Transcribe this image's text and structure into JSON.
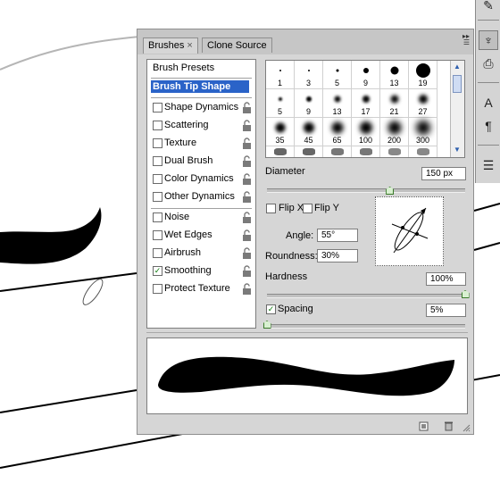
{
  "panel": {
    "tabs": [
      {
        "label": "Brushes",
        "close": "×",
        "active": true
      },
      {
        "label": "Clone Source",
        "active": false
      }
    ],
    "options": [
      {
        "label": "Brush Presets",
        "type": "header"
      },
      {
        "label": "Brush Tip Shape",
        "type": "selected"
      },
      {
        "label": "Shape Dynamics",
        "checked": false
      },
      {
        "label": "Scattering",
        "checked": false
      },
      {
        "label": "Texture",
        "checked": false
      },
      {
        "label": "Dual Brush",
        "checked": false
      },
      {
        "label": "Color Dynamics",
        "checked": false
      },
      {
        "label": "Other Dynamics",
        "checked": false
      },
      {
        "label": "Noise",
        "checked": false
      },
      {
        "label": "Wet Edges",
        "checked": false
      },
      {
        "label": "Airbrush",
        "checked": false
      },
      {
        "label": "Smoothing",
        "checked": true
      },
      {
        "label": "Protect Texture",
        "checked": false
      }
    ],
    "presets": [
      "1",
      "3",
      "5",
      "9",
      "13",
      "19",
      "5",
      "9",
      "13",
      "17",
      "21",
      "27",
      "35",
      "45",
      "65",
      "100",
      "200",
      "300"
    ],
    "diameter": {
      "label": "Diameter",
      "value": "150 px",
      "level": 0.62
    },
    "flip_x": {
      "label": "Flip X",
      "checked": false
    },
    "flip_y": {
      "label": "Flip Y",
      "checked": false
    },
    "angle": {
      "label": "Angle:",
      "value": "55°"
    },
    "roundness": {
      "label": "Roundness:",
      "value": "30%"
    },
    "hardness": {
      "label": "Hardness",
      "value": "100%",
      "level": 1.0
    },
    "spacing": {
      "label": "Spacing",
      "value": "5%",
      "checked": true,
      "level": 0.0
    }
  },
  "colors": {
    "selection": "#2a63c8",
    "panel": "#d6d6d6",
    "slider_knob": "#3a7a2a"
  }
}
